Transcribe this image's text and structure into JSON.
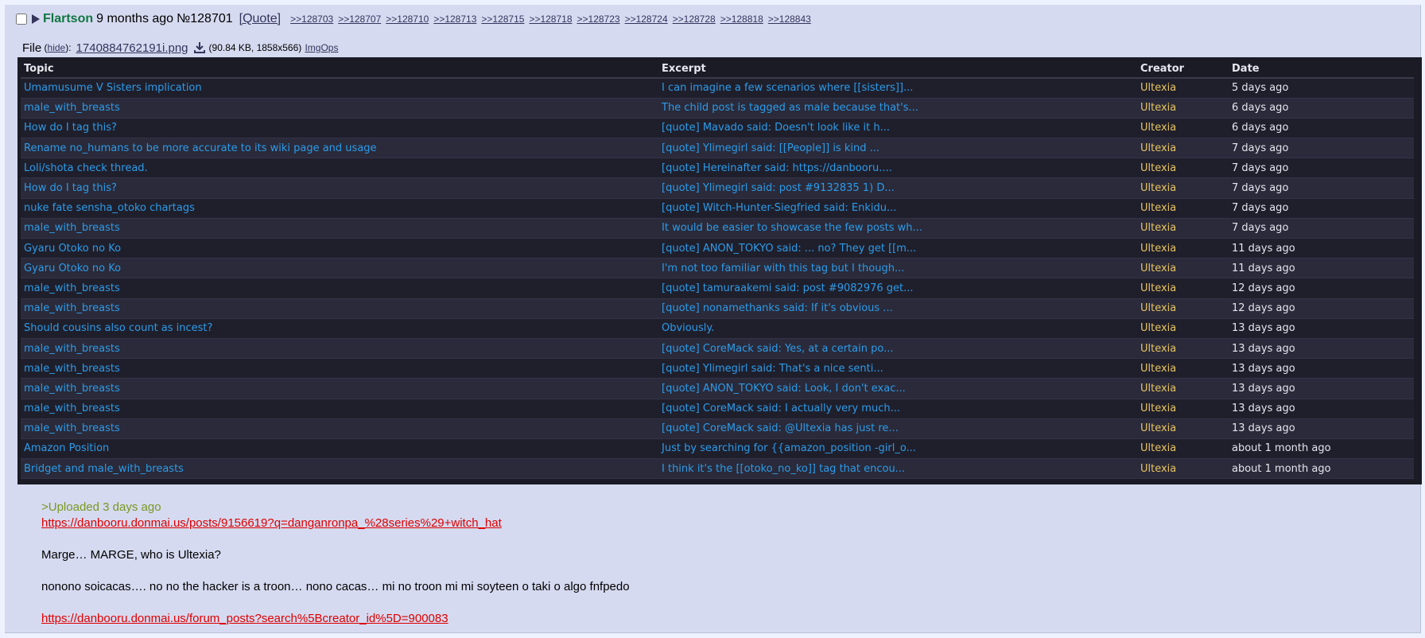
{
  "post": {
    "name": "Flartson",
    "time": "9 months ago",
    "number": "№128701",
    "quote_label": "[Quote]",
    "backlinks": [
      ">>128703",
      ">>128707",
      ">>128710",
      ">>128713",
      ">>128715",
      ">>128718",
      ">>128723",
      ">>128724",
      ">>128728",
      ">>128818",
      ">>128843"
    ]
  },
  "file": {
    "label": "File",
    "hide": "hide",
    "filename": "1740884762191i.png",
    "meta": "(90.84 KB, 1858x566)",
    "imgops": "ImgOps"
  },
  "table": {
    "headers": [
      "Topic",
      "Excerpt",
      "Creator",
      "Date"
    ],
    "rows": [
      {
        "topic": "Umamusume V Sisters implication",
        "excerpt": "I can imagine a few scenarios where [[sisters]]...",
        "creator": "Ultexia",
        "date": "5 days ago"
      },
      {
        "topic": "male_with_breasts",
        "excerpt": "The child post is tagged as male because that's...",
        "creator": "Ultexia",
        "date": "6 days ago"
      },
      {
        "topic": "How do I tag this?",
        "excerpt": "[quote] Mavado said: Doesn't look like it h...",
        "creator": "Ultexia",
        "date": "6 days ago"
      },
      {
        "topic": "Rename no_humans to be more accurate to its wiki page and usage",
        "excerpt": "[quote] Ylimegirl said: [[People]] is kind ...",
        "creator": "Ultexia",
        "date": "7 days ago"
      },
      {
        "topic": "Loli/shota check thread.",
        "excerpt": "[quote] Hereinafter said: https://danbooru....",
        "creator": "Ultexia",
        "date": "7 days ago"
      },
      {
        "topic": "How do I tag this?",
        "excerpt": "[quote] Ylimegirl said: post #9132835 1) D...",
        "creator": "Ultexia",
        "date": "7 days ago"
      },
      {
        "topic": "nuke fate sensha_otoko chartags",
        "excerpt": "[quote] Witch-Hunter-Siegfried said: Enkidu...",
        "creator": "Ultexia",
        "date": "7 days ago"
      },
      {
        "topic": "male_with_breasts",
        "excerpt": "It would be easier to showcase the few posts wh...",
        "creator": "Ultexia",
        "date": "7 days ago"
      },
      {
        "topic": "Gyaru Otoko no Ko",
        "excerpt": "[quote] ANON_TOKYO said: ... no? They get [[m...",
        "creator": "Ultexia",
        "date": "11 days ago"
      },
      {
        "topic": "Gyaru Otoko no Ko",
        "excerpt": "I'm not too familiar with this tag but I though...",
        "creator": "Ultexia",
        "date": "11 days ago"
      },
      {
        "topic": "male_with_breasts",
        "excerpt": "[quote] tamuraakemi said: post #9082976 get...",
        "creator": "Ultexia",
        "date": "12 days ago"
      },
      {
        "topic": "male_with_breasts",
        "excerpt": "[quote] nonamethanks said: If it's obvious ...",
        "creator": "Ultexia",
        "date": "12 days ago"
      },
      {
        "topic": "Should cousins also count as incest?",
        "excerpt": "Obviously.",
        "creator": "Ultexia",
        "date": "13 days ago"
      },
      {
        "topic": "male_with_breasts",
        "excerpt": "[quote] CoreMack said: Yes, at a certain po...",
        "creator": "Ultexia",
        "date": "13 days ago"
      },
      {
        "topic": "male_with_breasts",
        "excerpt": "[quote] Ylimegirl said: That's a nice senti...",
        "creator": "Ultexia",
        "date": "13 days ago"
      },
      {
        "topic": "male_with_breasts",
        "excerpt": "[quote] ANON_TOKYO said: Look, I don't exac...",
        "creator": "Ultexia",
        "date": "13 days ago"
      },
      {
        "topic": "male_with_breasts",
        "excerpt": "[quote] CoreMack said: I actually very much...",
        "creator": "Ultexia",
        "date": "13 days ago"
      },
      {
        "topic": "male_with_breasts",
        "excerpt": "[quote] CoreMack said: @Ultexia has just re...",
        "creator": "Ultexia",
        "date": "13 days ago"
      },
      {
        "topic": "Amazon Position",
        "excerpt": "Just by searching for {{amazon_position -girl_o...",
        "creator": "Ultexia",
        "date": "about 1 month ago"
      },
      {
        "topic": "Bridget and male_with_breasts",
        "excerpt": "I think it's the [[otoko_no_ko]] tag that encou...",
        "creator": "Ultexia",
        "date": "about 1 month ago"
      }
    ]
  },
  "body": {
    "greentext": ">Uploaded 3 days ago",
    "link1": "https://danbooru.donmai.us/posts/9156619?q=danganronpa_%28series%29+witch_hat",
    "line1": "Marge… MARGE, who is Ultexia?",
    "line2": "nonono soicacas…. no no the hacker is a troon… nono cacas… mi no troon mi mi soyteen o taki o algo fnfpedo",
    "link2": "https://danbooru.donmai.us/forum_posts?search%5Bcreator_id%5D=900083"
  },
  "icons": {
    "expand": "triangle-right-icon",
    "download": "download-icon"
  },
  "colors": {
    "post_bg": "#d6daf0",
    "name": "#117743",
    "link": "#dd0000",
    "greentext": "#789922",
    "table_bg": "#1b1b25",
    "topic": "#2d9be8",
    "creator": "#e8c460"
  }
}
